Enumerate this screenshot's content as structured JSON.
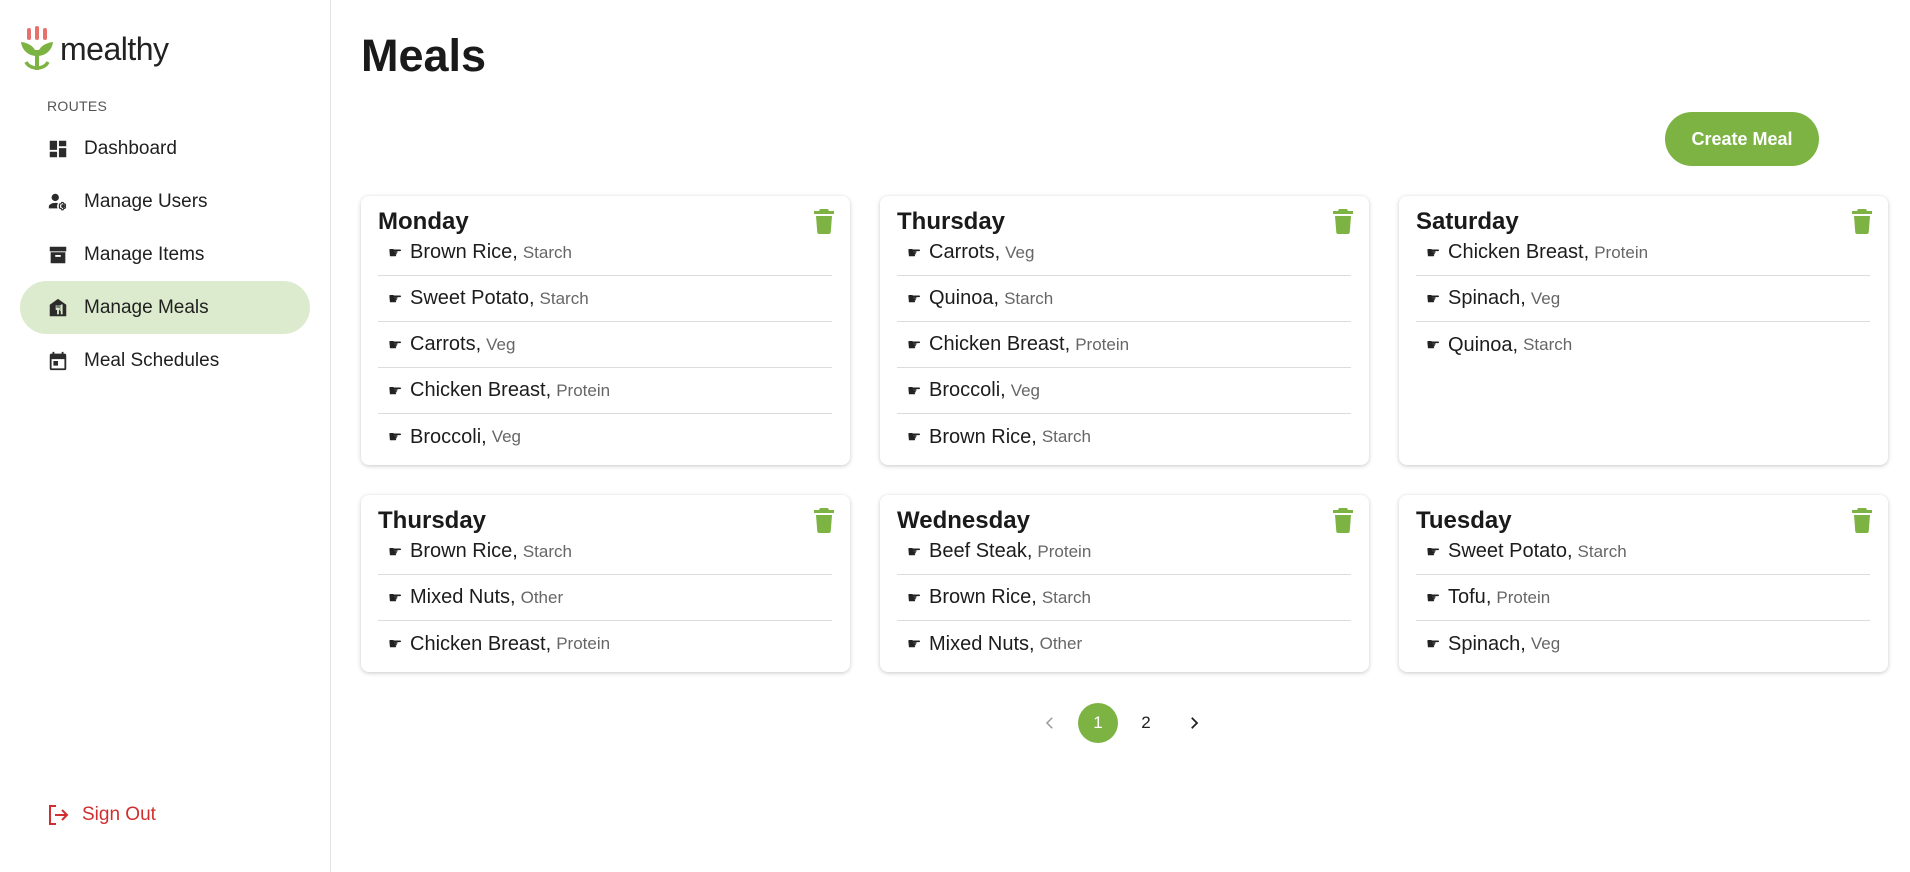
{
  "brand": {
    "name": "mealthy",
    "accent": "#7cb342"
  },
  "sidebar": {
    "section_label": "ROUTES",
    "items": [
      {
        "label": "Dashboard",
        "icon": "dashboard-icon"
      },
      {
        "label": "Manage Users",
        "icon": "manage-accounts-icon"
      },
      {
        "label": "Manage Items",
        "icon": "archive-box-icon"
      },
      {
        "label": "Manage Meals",
        "icon": "food-bank-icon",
        "active": true
      },
      {
        "label": "Meal Schedules",
        "icon": "calendar-icon"
      }
    ],
    "signout_label": "Sign Out"
  },
  "main": {
    "title": "Meals",
    "create_label": "Create Meal",
    "meals": [
      {
        "day": "Monday",
        "items": [
          {
            "name": "Brown Rice",
            "category": "Starch"
          },
          {
            "name": "Sweet Potato",
            "category": "Starch"
          },
          {
            "name": "Carrots",
            "category": "Veg"
          },
          {
            "name": "Chicken Breast",
            "category": "Protein"
          },
          {
            "name": "Broccoli",
            "category": "Veg"
          }
        ]
      },
      {
        "day": "Thursday",
        "items": [
          {
            "name": "Carrots",
            "category": "Veg"
          },
          {
            "name": "Quinoa",
            "category": "Starch"
          },
          {
            "name": "Chicken Breast",
            "category": "Protein"
          },
          {
            "name": "Broccoli",
            "category": "Veg"
          },
          {
            "name": "Brown Rice",
            "category": "Starch"
          }
        ]
      },
      {
        "day": "Saturday",
        "items": [
          {
            "name": "Chicken Breast",
            "category": "Protein"
          },
          {
            "name": "Spinach",
            "category": "Veg"
          },
          {
            "name": "Quinoa",
            "category": "Starch"
          }
        ]
      },
      {
        "day": "Thursday",
        "items": [
          {
            "name": "Brown Rice",
            "category": "Starch"
          },
          {
            "name": "Mixed Nuts",
            "category": "Other"
          },
          {
            "name": "Chicken Breast",
            "category": "Protein"
          }
        ]
      },
      {
        "day": "Wednesday",
        "items": [
          {
            "name": "Beef Steak",
            "category": "Protein"
          },
          {
            "name": "Brown Rice",
            "category": "Starch"
          },
          {
            "name": "Mixed Nuts",
            "category": "Other"
          }
        ]
      },
      {
        "day": "Tuesday",
        "items": [
          {
            "name": "Sweet Potato",
            "category": "Starch"
          },
          {
            "name": "Tofu",
            "category": "Protein"
          },
          {
            "name": "Spinach",
            "category": "Veg"
          }
        ]
      }
    ],
    "item_marker": "☛",
    "pagination": {
      "pages": [
        "1",
        "2"
      ],
      "current": "1"
    }
  }
}
